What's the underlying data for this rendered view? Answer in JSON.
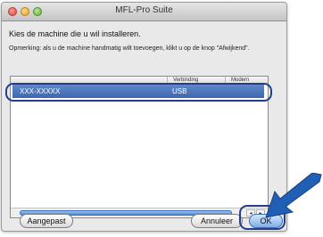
{
  "window": {
    "title": "MFL-Pro Suite"
  },
  "dialog": {
    "heading": "Kies de machine die u wil installeren.",
    "note": "Opmerking: als u de machine handmatig wilt toevoegen, klikt u op de knop \"Afwijkend\"."
  },
  "list": {
    "columns": [
      "",
      "Verbinding",
      "Modem"
    ],
    "rows": [
      {
        "name": "XXX-XXXXX",
        "connection": "USB"
      }
    ]
  },
  "buttons": {
    "custom_label": "Aangepast",
    "cancel_label": "Annuleer",
    "ok_label": "OK"
  },
  "colors": {
    "selection": "#3d67b0",
    "highlight_ring": "#1f3f8a",
    "arrow": "#1f5fb5"
  },
  "icons": {
    "scroll_left": "◂",
    "scroll_right": "▸"
  }
}
